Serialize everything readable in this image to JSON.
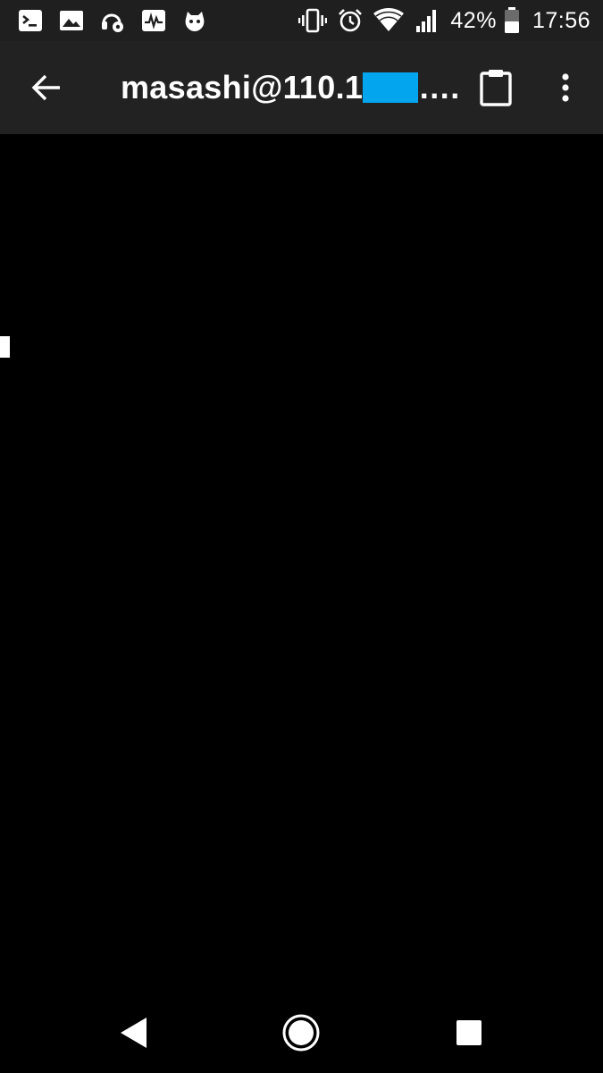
{
  "status_bar": {
    "notification_icons": [
      "terminal-icon",
      "image-icon",
      "headphones-settings-icon",
      "activity-monitor-icon",
      "app-mascot-icon"
    ],
    "system_icons": [
      "vibrate-icon",
      "alarm-icon",
      "wifi-icon",
      "cellular-signal-icon",
      "battery-icon"
    ],
    "battery_percent": "42%",
    "time": "17:56"
  },
  "app_bar": {
    "title_prefix": "masashi@110.1",
    "title_suffix": "….",
    "redaction_color": "#03a5ef",
    "back_icon": "arrow-back-icon",
    "paste_icon": "clipboard-icon",
    "menu_icon": "more-vert-icon"
  },
  "terminal": {
    "background": "#000000",
    "cursor_color": "#ffffff"
  },
  "nav_bar": {
    "buttons": [
      "back-triangle-icon",
      "home-circle-icon",
      "recents-square-icon"
    ]
  }
}
